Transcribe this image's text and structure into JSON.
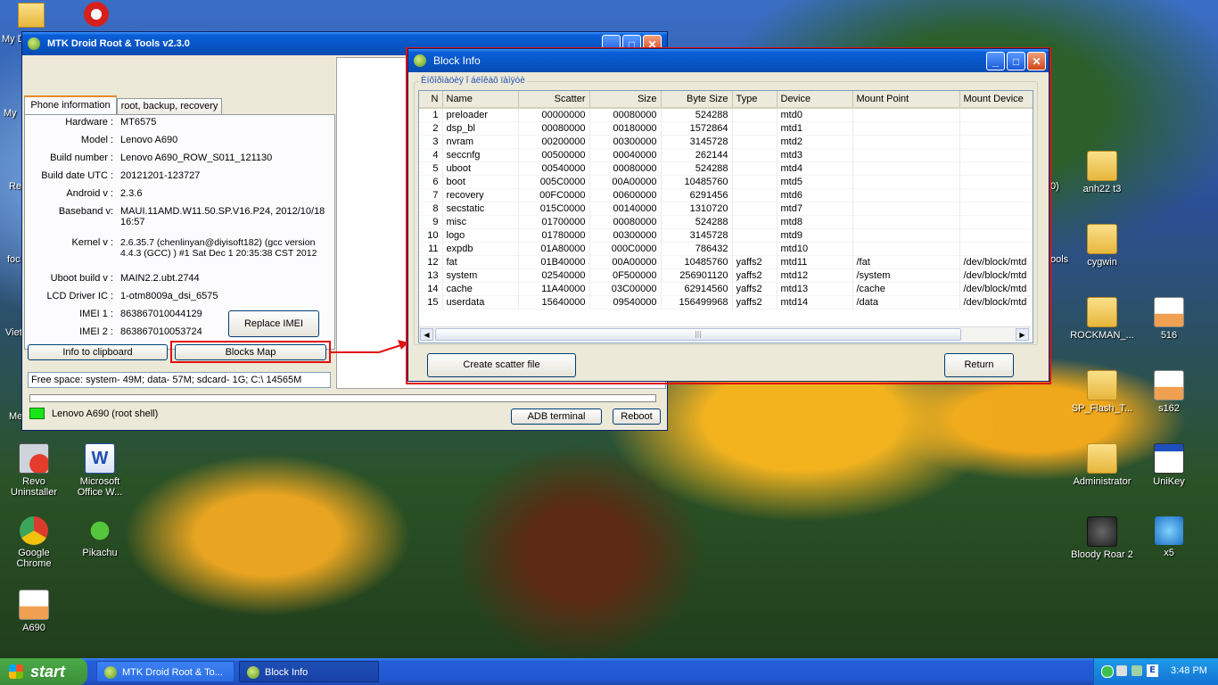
{
  "desktop": {
    "left_icons": [
      {
        "label": "Revo Uninstaller",
        "icon": "revo-icon"
      },
      {
        "label": "Microsoft Office W...",
        "icon": "word-icon"
      },
      {
        "label": "Google Chrome",
        "icon": "chrome-icon"
      },
      {
        "label": "Pikachu",
        "icon": "pikachu-icon"
      },
      {
        "label": "A690",
        "icon": "file-icon"
      }
    ],
    "partial_left": [
      "My D",
      "My",
      "Re",
      "foc",
      "Viet",
      "Me"
    ],
    "right_icons": [
      {
        "label": "anh22 t3",
        "icon": "folder-icon"
      },
      {
        "label": "cygwin",
        "icon": "folder-icon"
      },
      {
        "label": "ROCKMAN_...",
        "icon": "folder-icon"
      },
      {
        "label": "516",
        "icon": "file-icon"
      },
      {
        "label": "SP_Flash_T...",
        "icon": "folder-icon"
      },
      {
        "label": "s162",
        "icon": "file-icon"
      },
      {
        "label": "Administrator",
        "icon": "folder-icon"
      },
      {
        "label": "UniKey",
        "icon": "unikey-icon"
      },
      {
        "label": "Bloody Roar 2",
        "icon": "game-icon"
      },
      {
        "label": "x5",
        "icon": "x5-icon"
      }
    ],
    "partial_right": [
      "0)",
      "ools"
    ]
  },
  "main_window": {
    "title": "MTK Droid Root & Tools v2.3.0",
    "tabs": [
      "Phone information",
      "root, backup, recovery"
    ],
    "fields": [
      {
        "label": "Hardware :",
        "value": "MT6575"
      },
      {
        "label": "Model :",
        "value": "Lenovo A690"
      },
      {
        "label": "Build number :",
        "value": "Lenovo A690_ROW_S011_121130"
      },
      {
        "label": "Build date UTC :",
        "value": "20121201-123727"
      },
      {
        "label": "Android  v :",
        "value": "2.3.6"
      },
      {
        "label": "Baseband v:",
        "value": "MAUI.11AMD.W11.50.SP.V16.P24, 2012/10/18 16:57"
      },
      {
        "label": "Kernel v :",
        "value": "2.6.35.7 (chenlinyan@diyisoft182) (gcc version 4.4.3 (GCC) ) #1  Sat Dec 1 20:35:38 CST 2012"
      },
      {
        "label": "Uboot build v :",
        "value": "MAIN2.2.ubt.2744"
      },
      {
        "label": "LCD Driver IC :",
        "value": "1-otm8009a_dsi_6575"
      },
      {
        "label": "IMEI 1 :",
        "value": "863867010044129"
      },
      {
        "label": "IMEI 2 :",
        "value": "863867010053724"
      }
    ],
    "replace_imei": "Replace IMEI",
    "info_clipboard": "Info to clipboard",
    "blocks_map": "Blocks Map",
    "free_space": "Free space: system- 49M; data- 57M; sdcard- 1G;  C:\\ 14565M",
    "status": "Lenovo A690 (root shell)",
    "adb_terminal": "ADB terminal",
    "reboot": "Reboot",
    "status_color": "#19e619"
  },
  "block_window": {
    "title": "Block Info",
    "group_caption": "Èíôîðìàöèÿ î áëîêàõ ïàìÿòè",
    "columns": [
      "N",
      "Name",
      "Scatter",
      "Size",
      "Byte Size",
      "Type",
      "Device",
      "Mount Point",
      "Mount Device"
    ],
    "rows": [
      [
        "1",
        "preloader",
        "00000000",
        "00080000",
        "524288",
        "",
        "mtd0",
        "",
        ""
      ],
      [
        "2",
        "dsp_bl",
        "00080000",
        "00180000",
        "1572864",
        "",
        "mtd1",
        "",
        ""
      ],
      [
        "3",
        "nvram",
        "00200000",
        "00300000",
        "3145728",
        "",
        "mtd2",
        "",
        ""
      ],
      [
        "4",
        "seccnfg",
        "00500000",
        "00040000",
        "262144",
        "",
        "mtd3",
        "",
        ""
      ],
      [
        "5",
        "uboot",
        "00540000",
        "00080000",
        "524288",
        "",
        "mtd4",
        "",
        ""
      ],
      [
        "6",
        "boot",
        "005C0000",
        "00A00000",
        "10485760",
        "",
        "mtd5",
        "",
        ""
      ],
      [
        "7",
        "recovery",
        "00FC0000",
        "00600000",
        "6291456",
        "",
        "mtd6",
        "",
        ""
      ],
      [
        "8",
        "secstatic",
        "015C0000",
        "00140000",
        "1310720",
        "",
        "mtd7",
        "",
        ""
      ],
      [
        "9",
        "misc",
        "01700000",
        "00080000",
        "524288",
        "",
        "mtd8",
        "",
        ""
      ],
      [
        "10",
        "logo",
        "01780000",
        "00300000",
        "3145728",
        "",
        "mtd9",
        "",
        ""
      ],
      [
        "11",
        "expdb",
        "01A80000",
        "000C0000",
        "786432",
        "",
        "mtd10",
        "",
        ""
      ],
      [
        "12",
        "fat",
        "01B40000",
        "00A00000",
        "10485760",
        "yaffs2",
        "mtd11",
        "/fat",
        "/dev/block/mtd"
      ],
      [
        "13",
        "system",
        "02540000",
        "0F500000",
        "256901120",
        "yaffs2",
        "mtd12",
        "/system",
        "/dev/block/mtd"
      ],
      [
        "14",
        "cache",
        "11A40000",
        "03C00000",
        "62914560",
        "yaffs2",
        "mtd13",
        "/cache",
        "/dev/block/mtd"
      ],
      [
        "15",
        "userdata",
        "15640000",
        "09540000",
        "156499968",
        "yaffs2",
        "mtd14",
        "/data",
        "/dev/block/mtd"
      ]
    ],
    "create_scatter": "Create scatter file",
    "return": "Return",
    "highlight_color": "#e01010"
  },
  "taskbar": {
    "start": "start",
    "tasks": [
      "MTK Droid Root & To...",
      "Block Info"
    ],
    "clock": "3:48 PM"
  }
}
